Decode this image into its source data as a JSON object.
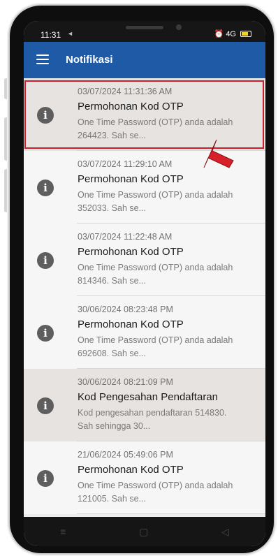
{
  "status_bar": {
    "time": "11:31",
    "left_icon": "◄",
    "right_icons": "⏰ 4G"
  },
  "app_bar": {
    "title": "Notifikasi"
  },
  "notifications": [
    {
      "date": "03/07/2024 11:31:36 AM",
      "title": "Permohonan Kod OTP",
      "body": "One Time Password (OTP) anda adalah 264423. Sah se..."
    },
    {
      "date": "03/07/2024 11:29:10 AM",
      "title": "Permohonan Kod OTP",
      "body": "One Time Password (OTP) anda adalah 352033. Sah se..."
    },
    {
      "date": "03/07/2024 11:22:48 AM",
      "title": "Permohonan Kod OTP",
      "body": "One Time Password (OTP) anda adalah 814346. Sah se..."
    },
    {
      "date": "30/06/2024 08:23:48 PM",
      "title": "Permohonan Kod OTP",
      "body": "One Time Password (OTP) anda adalah 692608. Sah se..."
    },
    {
      "date": "30/06/2024 08:21:09 PM",
      "title": "Kod Pengesahan Pendaftaran",
      "body": "Kod pengesahan pendaftaran 514830. Sah sehingga 30..."
    },
    {
      "date": "21/06/2024 05:49:06 PM",
      "title": "Permohonan Kod OTP",
      "body": "One Time Password (OTP) anda adalah 121005. Sah se..."
    }
  ],
  "nav_bar": {
    "menu_glyph": "≡",
    "home_glyph": "▢",
    "back_glyph": "◁"
  },
  "colors": {
    "app_bar": "#1f5aa6",
    "highlight": "#c8202a",
    "read_row": "#e7e3e1"
  }
}
